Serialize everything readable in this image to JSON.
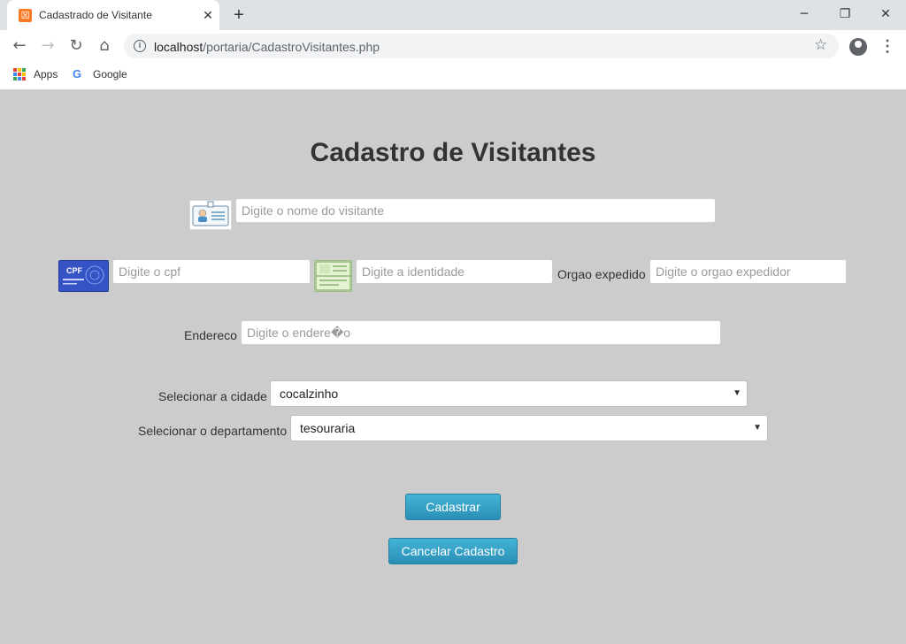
{
  "browser": {
    "tab_title": "Cadastrado de Visitante",
    "tab_close": "✕",
    "new_tab": "+",
    "url_host": "localhost",
    "url_path": "/portaria/CadastroVisitantes.php",
    "bookmarks": [
      {
        "label": "Apps"
      },
      {
        "label": "Google"
      }
    ]
  },
  "page": {
    "title": "Cadastro de Visitantes",
    "nome_placeholder": "Digite o nome do visitante",
    "cpf_placeholder": "Digite o cpf",
    "identidade_placeholder": "Digite a identidade",
    "orgao_label": "Orgao expedido",
    "orgao_placeholder": "Digite o orgao expedidor",
    "endereco_label": "Endereco",
    "endereco_placeholder": "Digite o endere�o",
    "cidade_label": "Selecionar a cidade",
    "cidade_value": "cocalzinho",
    "departamento_label": "Selecionar o departamento",
    "departamento_value": "tesouraria",
    "cadastrar_label": "Cadastrar",
    "cancelar_label": "Cancelar Cadastro",
    "cpf_card_text": "CPF"
  },
  "colors": {
    "page_background": "#cccccc",
    "button_accent": "#3aa6cc",
    "cpf_card": "#3553c4"
  }
}
